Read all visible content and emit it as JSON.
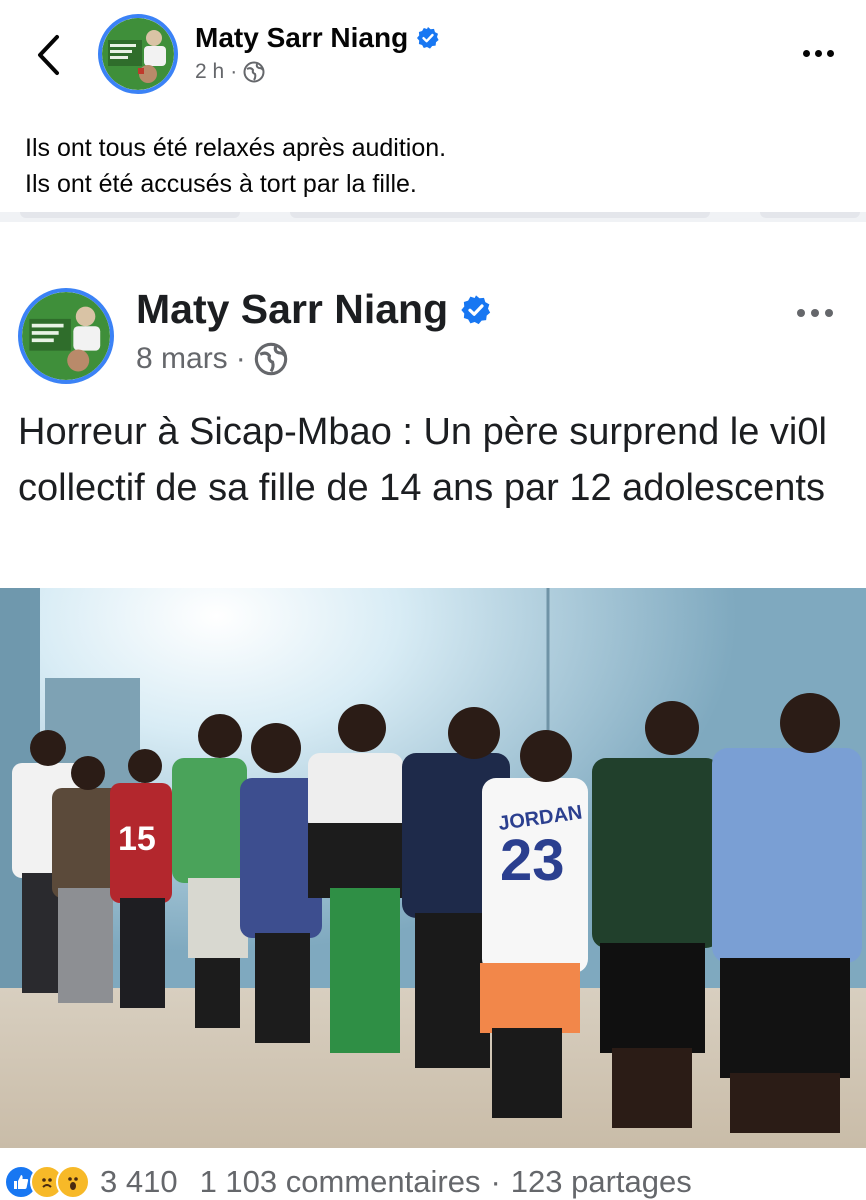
{
  "header": {
    "back_icon": "chevron-left-icon",
    "author": "Maty Sarr Niang",
    "verified_icon": "verified-badge-icon",
    "time": "2 h",
    "separator": "·",
    "audience_icon": "globe-icon",
    "more_icon": "more-horizontal-icon"
  },
  "caption": {
    "line1": "Ils ont tous été relaxés après audition.",
    "line2": "Ils ont été accusés à tort par la fille."
  },
  "shared_post": {
    "author": "Maty Sarr Niang",
    "time": "8 mars",
    "separator": "·",
    "audience_icon": "globe-icon",
    "more_icon": "more-horizontal-icon",
    "text": "Horreur à Sicap-Mbao : Un père surprend le vi0l collectif de sa fille de 14 ans par 12 adolescents",
    "photo_jersey_text": "JORDAN",
    "photo_jersey_number": "23",
    "photo_jersey2_number": "15",
    "reactions_count": "3 410",
    "comments": "1 103 commentaires",
    "shares_separator": "·",
    "shares": "123 partages"
  },
  "colors": {
    "accent": "#1877f2",
    "avatar_ring": "#3b82f6",
    "muted_text": "#65676b",
    "wall": "#8fb7cc"
  }
}
